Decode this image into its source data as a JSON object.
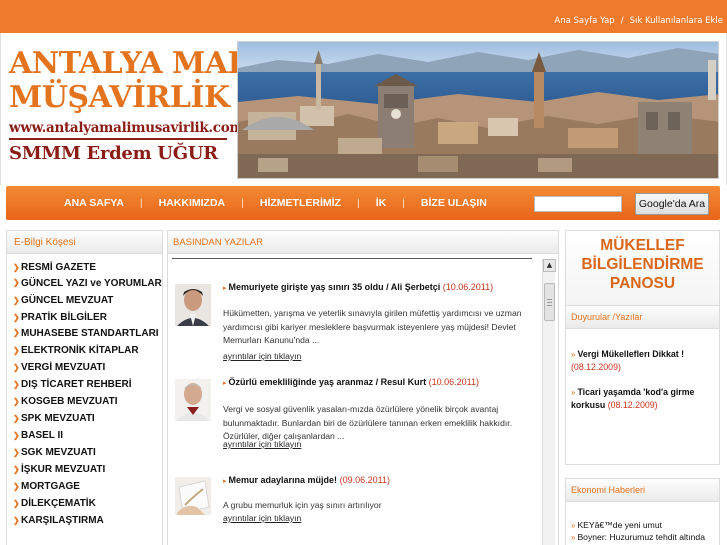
{
  "top_links": {
    "home": "Ana Sayfa Yap",
    "separator": "/",
    "favorites": "Sık Kullanılanlara Ekle"
  },
  "logo": {
    "line1": "ANTALYA MALİ",
    "line2": "MÜŞAVİRLİK",
    "url": "www.antalyamalimusavirlik.com",
    "name": "SMMM Erdem UĞUR"
  },
  "nav": {
    "items": [
      "ANA SAFYA",
      "HAKKIMIZDA",
      "HİZMETLERİMİZ",
      "İK",
      "BİZE ULAŞIN"
    ],
    "separator": "|",
    "search_placeholder": "",
    "search_button": "Google'da Ara"
  },
  "left_panel": {
    "title": "E-Bilgi Köşesi",
    "items": [
      "RESMİ GAZETE",
      "GÜNCEL YAZI ve YORUMLAR",
      "GÜNCEL MEVZUAT",
      "PRATİK BİLGİLER",
      "MUHASEBE STANDARTLARI",
      "ELEKTRONİK KİTAPLAR",
      "VERGİ MEVZUATI",
      "DIŞ TİCARET REHBERİ",
      "KOSGEB MEVZUATI",
      "SPK MEVZUATI",
      "BASEL II",
      "SGK MEVZUATI",
      "İŞKUR MEVZUATI",
      "MORTGAGE",
      "DİLEKÇEMATİK",
      "KARŞILAŞTIRMA"
    ]
  },
  "middle_panel": {
    "title": "BASINDAN YAZILAR",
    "news": [
      {
        "title": "Memuriyete girişte yaş sınırı 35 oldu / Ali Şerbetçi",
        "date": "(10.06.2011)",
        "text": "Hükümetten, yarışma ve yeterlik sınavıyla girilen müfettiş yardımcısı ve uzman yardımcısı gibi kariyer mesleklere başvurmak isteyenlere yaş müjdesi! Devlet Memurları Kanunu'nda ...",
        "more": "ayrıntılar için tıklayın"
      },
      {
        "title": "Özürlü emekliliğinde yaş aranmaz / Resul Kurt",
        "date": "(10.06.2011)",
        "text": "Vergi ve sosyal güvenlik yasaları-mızda özürlülere yönelik birçok avantaj bulunmaktadır. Bunlardan biri de özürlülere tanınan erken emeklilik hakkıdır. Özürlüler, diğer çalışanlardan ...",
        "more": "ayrıntılar için tıklayın"
      },
      {
        "title": "Memur adaylarına müjde!",
        "date": "(09.06.2011)",
        "text": "A grubu memurluk için yaş sınırı artırılıyor",
        "more": "ayrıntılar için tıklayın"
      }
    ]
  },
  "banner": {
    "line1": "MÜKELLEF",
    "line2": "BİLGİLENDİRME",
    "line3": "PANOSU"
  },
  "announcements": {
    "title": "Duyurular /Yazılar",
    "items": [
      {
        "title": "Vergi Mükelleflerı Dikkat !",
        "date": "(08.12.2009)"
      },
      {
        "title": "Ticari yaşamda 'kod'a girme korkusu",
        "date": "(08.12.2009)"
      }
    ]
  },
  "economy": {
    "title": "Ekonomi Haberleri",
    "items": [
      "KEYâ€™de yeni umut",
      "Boyner: Huzurumuz tehdit altında"
    ]
  },
  "colors": {
    "accent": "#f07a2b",
    "nav": "#e9651a",
    "date_red": "#c8341b",
    "logo_brown": "#8b1d16"
  }
}
